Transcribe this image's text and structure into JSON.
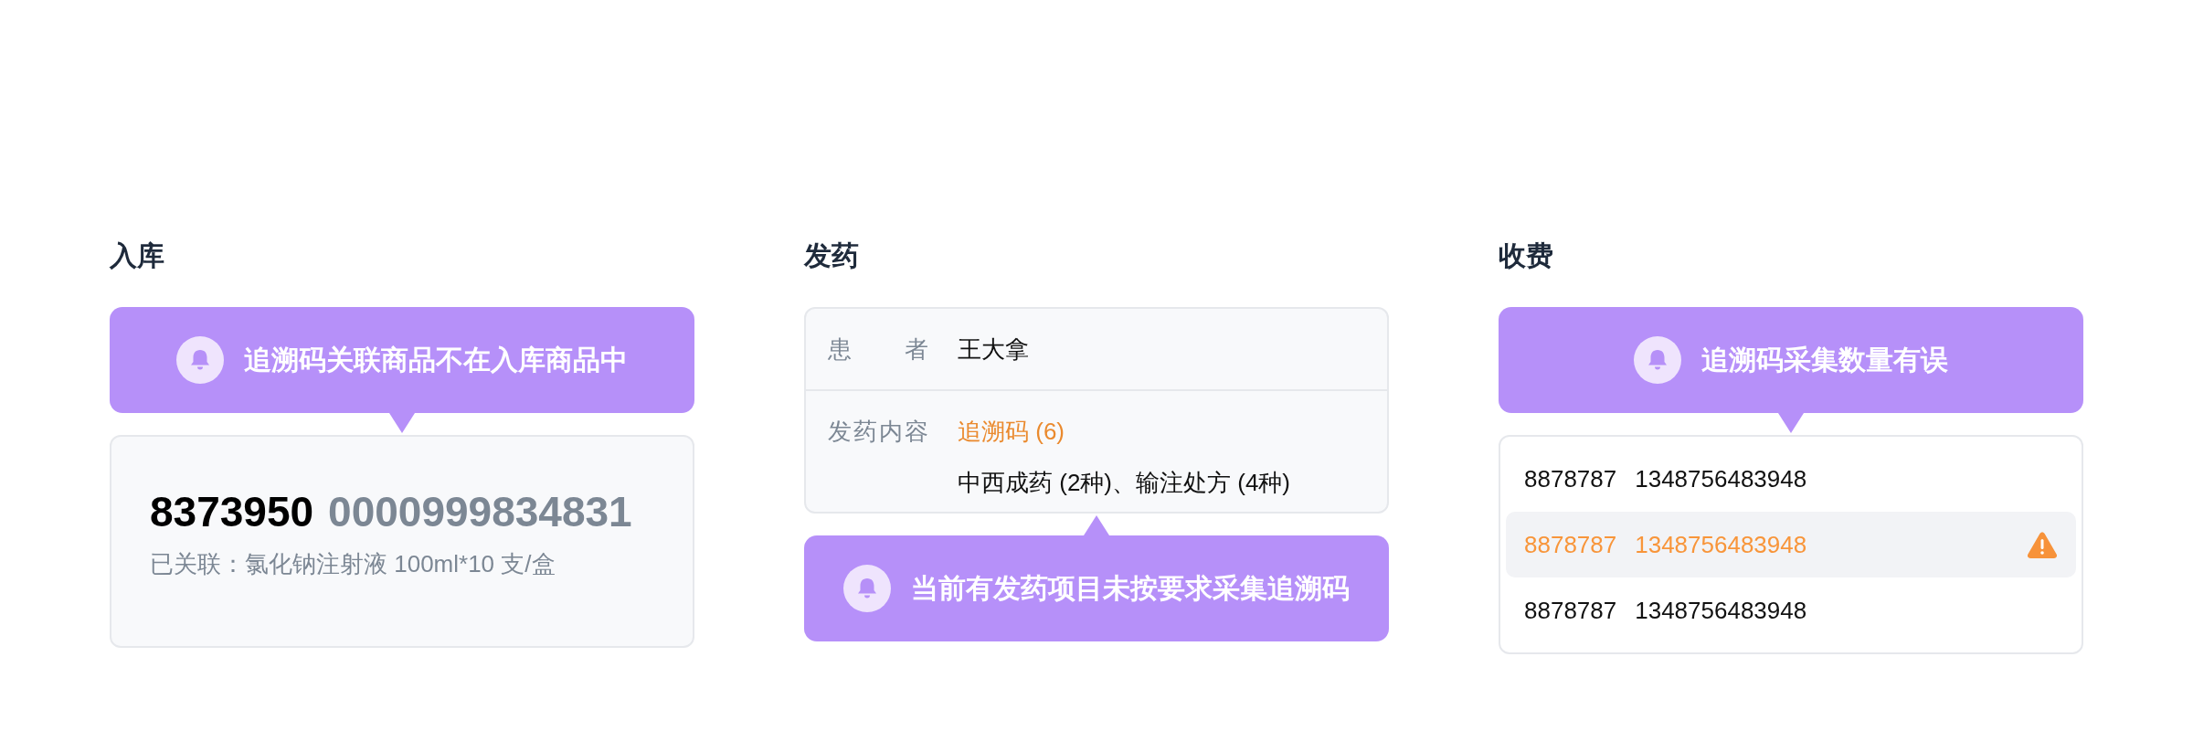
{
  "inbound": {
    "title": "入库",
    "alert": "追溯码关联商品不在入库商品中",
    "code_prefix": "8373950",
    "code_number": "0000999834831",
    "linked": "已关联：氯化钠注射液 100ml*10 支/盒"
  },
  "dispense": {
    "title": "发药",
    "fields": [
      {
        "label": "患者",
        "values": [
          {
            "text": "王大拿",
            "highlight": false
          }
        ]
      },
      {
        "label": "发药内容",
        "values": [
          {
            "text": "追溯码 (6)",
            "highlight": true
          },
          {
            "text": "中西成药 (2种)、输注处方 (4种)",
            "highlight": false
          }
        ]
      }
    ],
    "alert": "当前有发药项目未按要求采集追溯码"
  },
  "charge": {
    "title": "收费",
    "alert": "追溯码采集数量有误",
    "rows": [
      {
        "code": "8878787",
        "serial": "1348756483948",
        "warning": false
      },
      {
        "code": "8878787",
        "serial": "1348756483948",
        "warning": true
      },
      {
        "code": "8878787",
        "serial": "1348756483948",
        "warning": false
      }
    ]
  }
}
